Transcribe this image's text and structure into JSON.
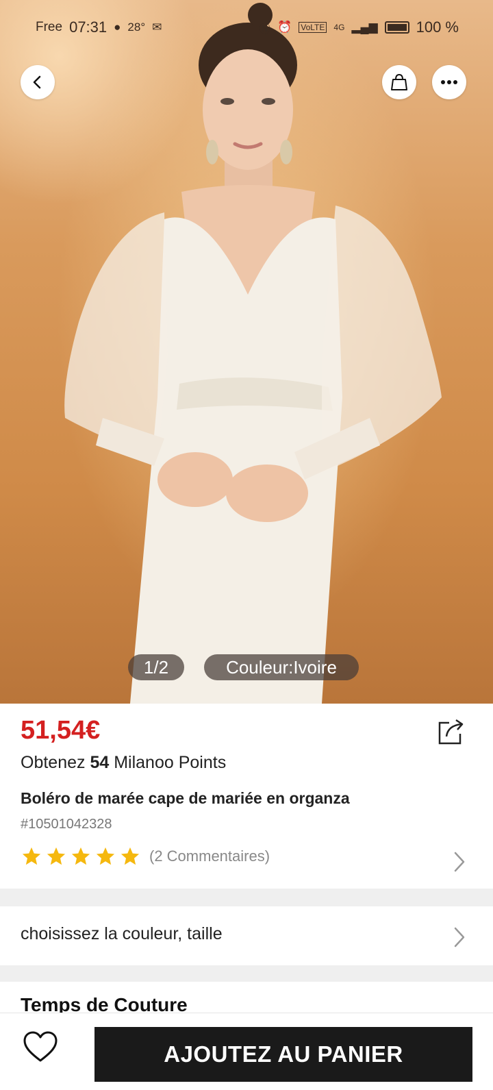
{
  "status_bar": {
    "carrier": "Free",
    "time": "07:31",
    "temperature": "28°",
    "network": "4G",
    "volte": "VoLTE",
    "battery": "100 %"
  },
  "gallery": {
    "pager": "1/2",
    "color_chip": "Couleur:Ivoire"
  },
  "product": {
    "price": "51,54€",
    "points_prefix": "Obtenez ",
    "points_value": "54",
    "points_suffix": " Milanoo Points",
    "title": "Boléro de marée cape de mariée en organza",
    "sku": "#10501042328",
    "rating": 5,
    "reviews": "(2 Commentaires)"
  },
  "options": {
    "label": "choisissez la couleur, taille"
  },
  "next_section": {
    "title": "Temps de Couture"
  },
  "bottom_bar": {
    "add_to_cart": "AJOUTEZ AU PANIER"
  },
  "colors": {
    "price_red": "#d42020",
    "star_gold": "#f5b80f",
    "cart_button": "#1a1a1a"
  },
  "icons": [
    "back-icon",
    "shopping-bag-icon",
    "more-icon",
    "share-icon",
    "star-icon",
    "chevron-right-icon",
    "heart-icon"
  ]
}
